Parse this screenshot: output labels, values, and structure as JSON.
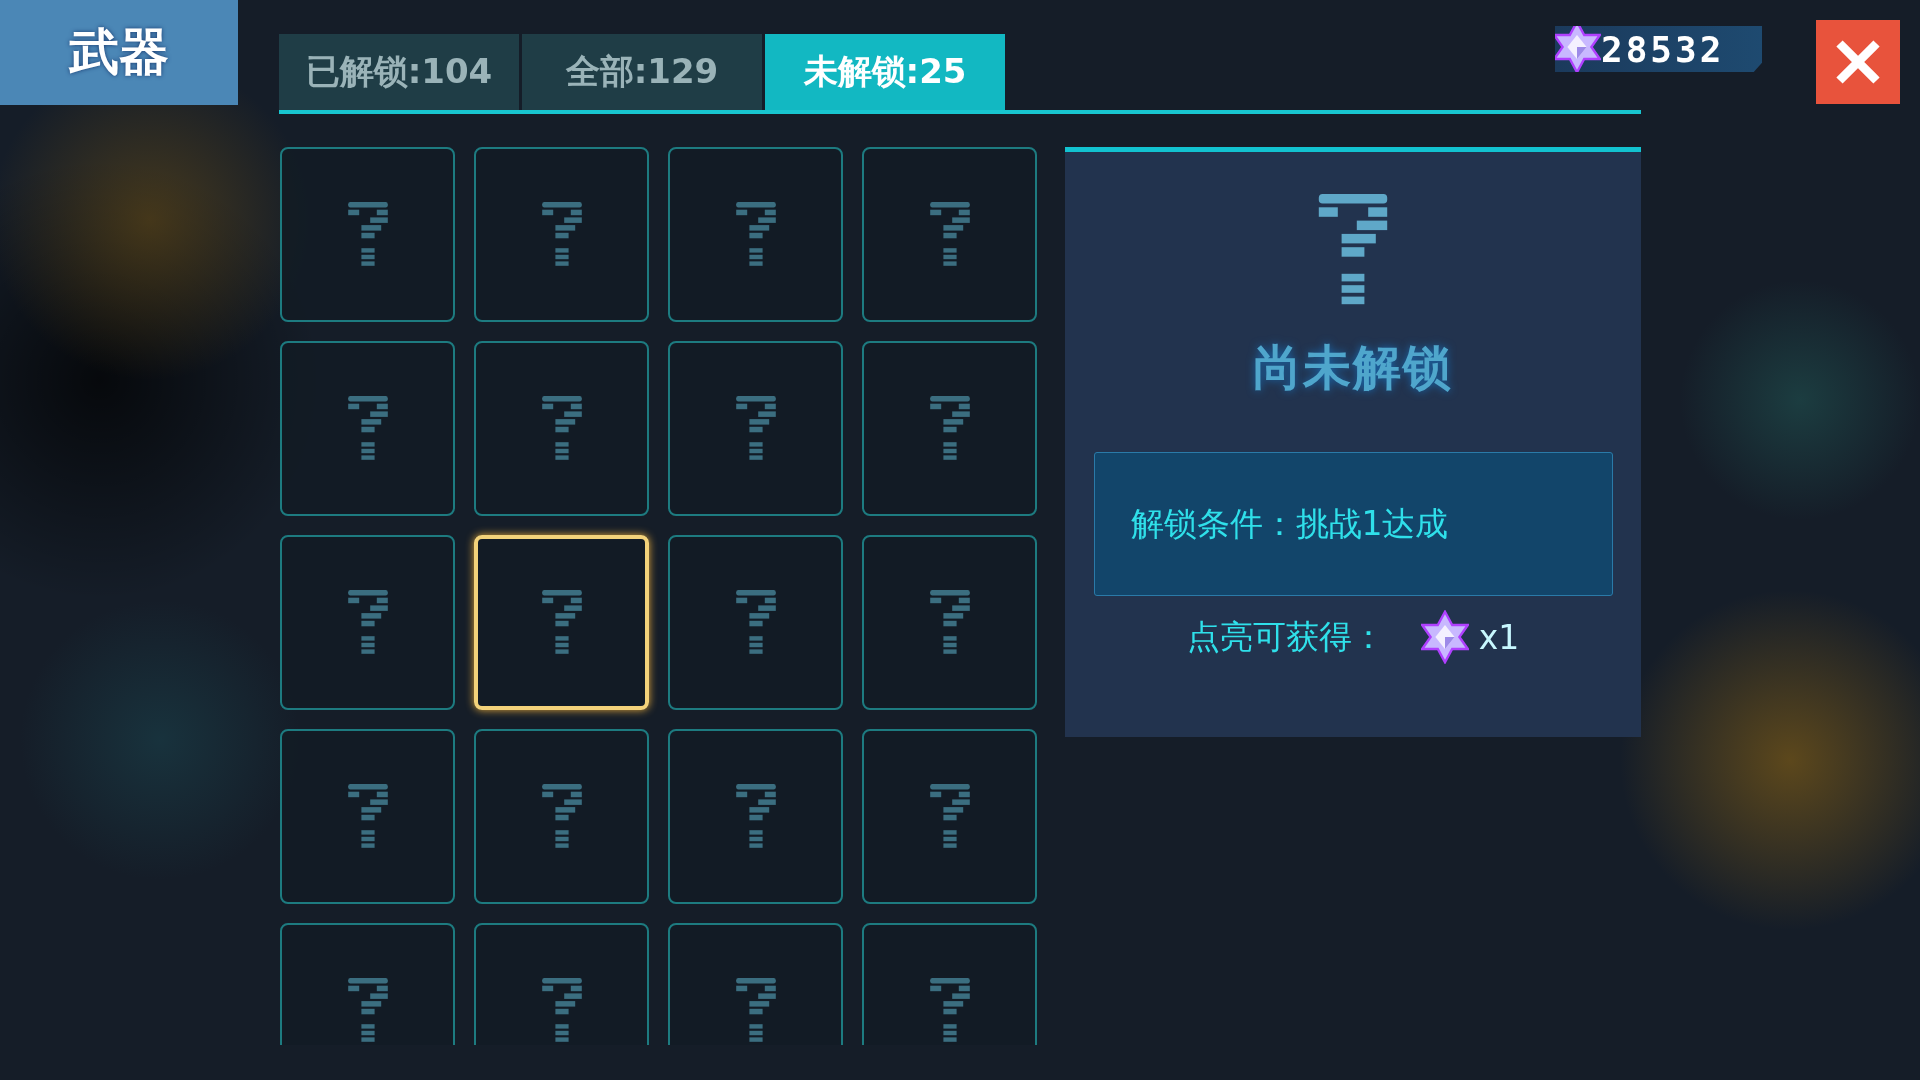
{
  "header": {
    "title": "武器"
  },
  "tabs": [
    {
      "label": "已解锁:104",
      "selected": false
    },
    {
      "label": "全部:129",
      "selected": false
    },
    {
      "label": "未解锁:25",
      "selected": true
    }
  ],
  "currency": {
    "amount": "28532"
  },
  "tiles": [
    {
      "selected": false
    },
    {
      "selected": false
    },
    {
      "selected": false
    },
    {
      "selected": false
    },
    {
      "selected": false
    },
    {
      "selected": false
    },
    {
      "selected": false
    },
    {
      "selected": false
    },
    {
      "selected": false
    },
    {
      "selected": true
    },
    {
      "selected": false
    },
    {
      "selected": false
    },
    {
      "selected": false
    },
    {
      "selected": false
    },
    {
      "selected": false
    },
    {
      "selected": false
    },
    {
      "selected": false
    },
    {
      "selected": false
    },
    {
      "selected": false
    },
    {
      "selected": false
    }
  ],
  "detail": {
    "status": "尚未解锁",
    "condition": "解锁条件：挑战1达成",
    "reward_label": "点亮可获得：",
    "reward_count": "x1"
  }
}
